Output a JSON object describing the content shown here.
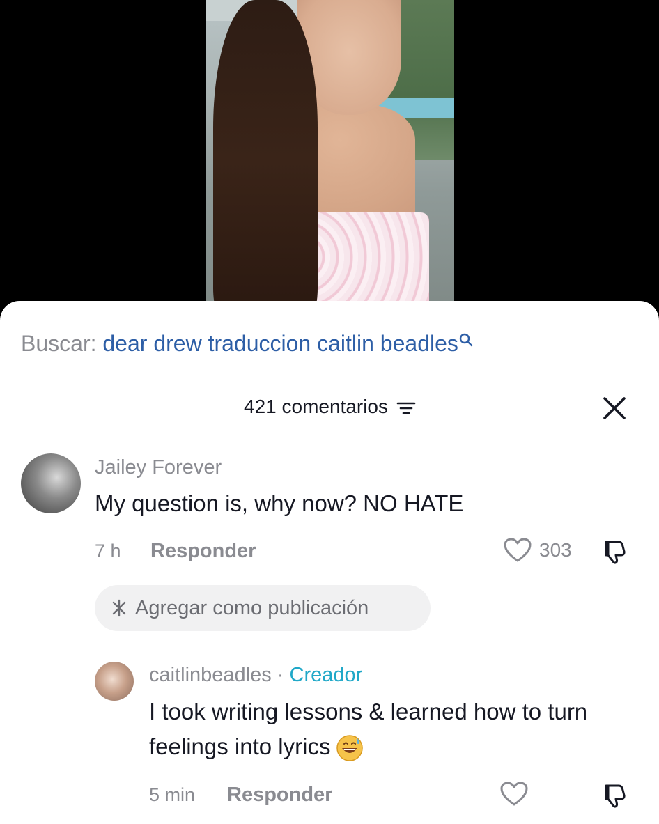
{
  "search": {
    "prefix": "Buscar:",
    "query": "dear drew traduccion caitlin beadles"
  },
  "header": {
    "comment_count": "421 comentarios"
  },
  "comments": [
    {
      "username": "Jailey Forever",
      "text": "My question is, why now? NO HATE",
      "time": "7 h",
      "reply_label": "Responder",
      "likes": "303"
    },
    {
      "username": "caitlinbeadles",
      "separator": "·",
      "badge": "Creador",
      "text": "I took writing lessons & learned how to turn feelings into lyrics",
      "emoji": "grinning-sweat-emoji",
      "time": "5 min",
      "reply_label": "Responder"
    }
  ],
  "add_post": {
    "label": "Agregar como publicación"
  },
  "colors": {
    "search_query": "#2d5ea6",
    "creator_badge": "#20a8c8",
    "secondary_text": "#8a8b91",
    "primary_text": "#161823"
  }
}
